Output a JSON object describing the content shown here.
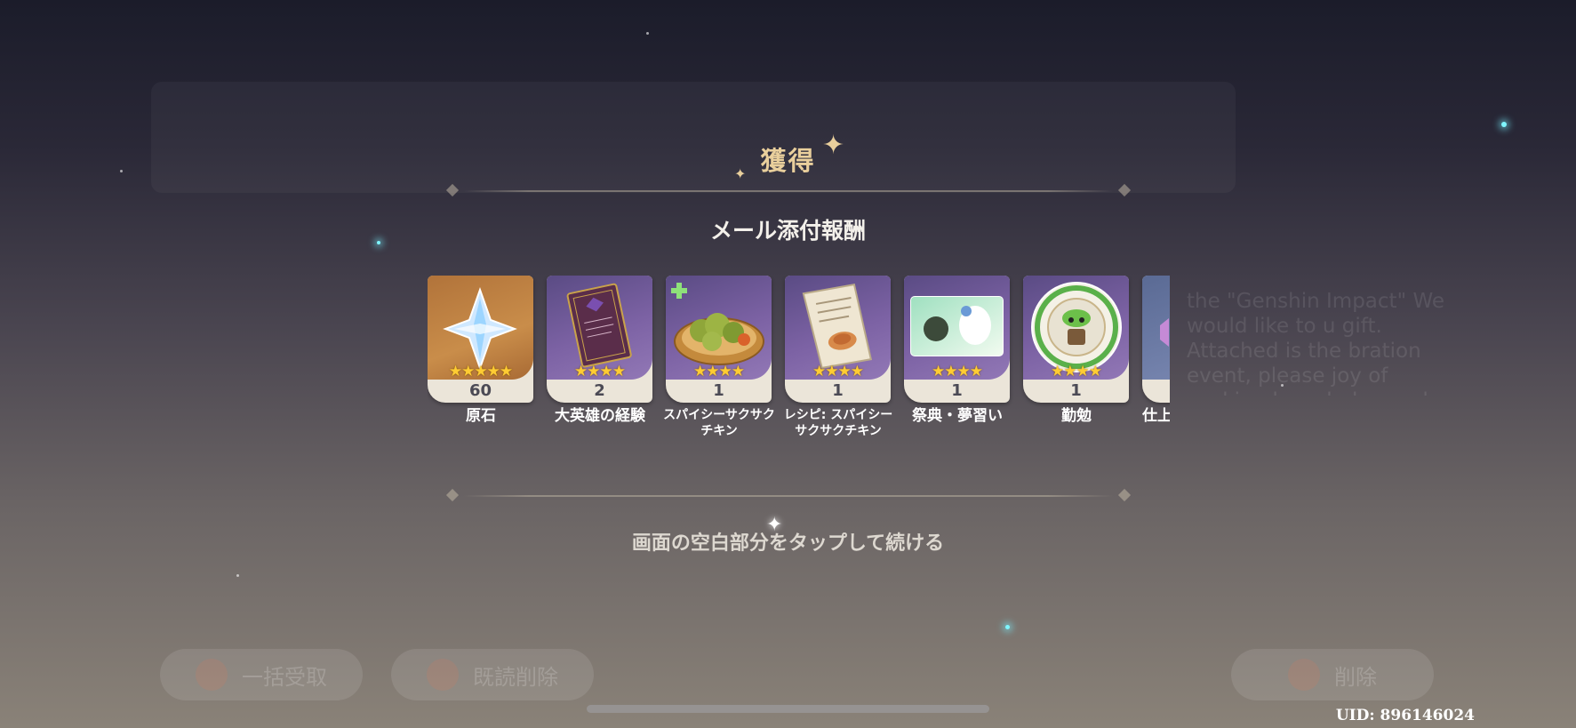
{
  "dialog": {
    "title": "獲得",
    "subtitle": "メール添付報酬",
    "hint": "画面の空白部分をタップして続ける"
  },
  "items": [
    {
      "name": "原石",
      "count": "60",
      "rarity": 5,
      "icon": "primogem-icon"
    },
    {
      "name": "大英雄の経験",
      "count": "2",
      "rarity": 4,
      "icon": "heros-wit-book-icon"
    },
    {
      "name": "スパイシーサクサクチキン",
      "count": "1",
      "rarity": 4,
      "icon": "spicy-chicken-dish-icon"
    },
    {
      "name": "レシピ: スパイシーサクサクチキン",
      "count": "1",
      "rarity": 4,
      "icon": "recipe-scroll-icon"
    },
    {
      "name": "祭典・夢習い",
      "count": "1",
      "rarity": 4,
      "icon": "namecard-icon"
    },
    {
      "name": "勤勉",
      "count": "1",
      "rarity": 4,
      "icon": "diligence-medal-icon"
    },
    {
      "name": "仕上",
      "count": "",
      "rarity": 4,
      "icon": "partial-item-icon"
    }
  ],
  "background": {
    "mail_text": "the \"Genshin Impact\" We would like to u gift. Attached is the bration event, please joy of seeking knowledge and wisdom always accompany you!",
    "claim_all_button": "一括受取",
    "delete_read_button": "既読削除",
    "delete_button": "削除"
  },
  "uid": "UID: 896146024"
}
